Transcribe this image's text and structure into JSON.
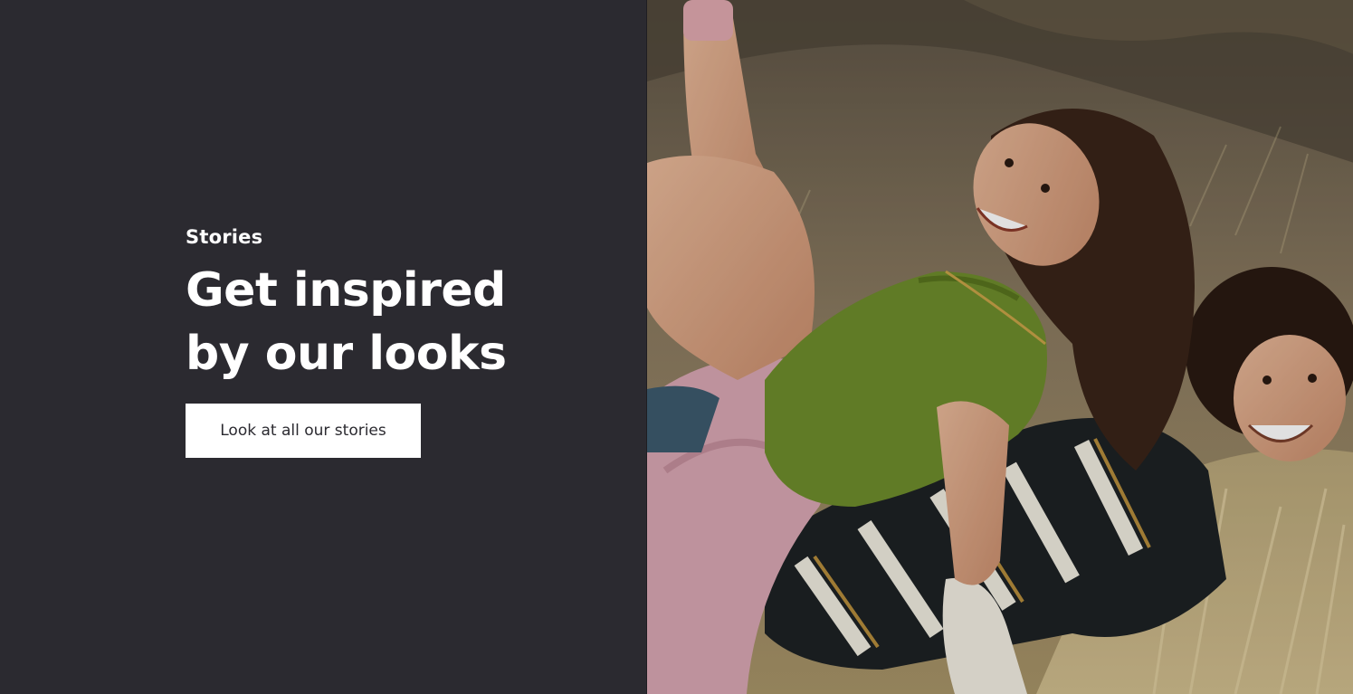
{
  "stories": {
    "eyebrow": "Stories",
    "headline_line1": "Get inspired",
    "headline_line2": "by our looks",
    "cta_label": "Look at all our stories"
  },
  "colors": {
    "panel_background": "#2b2a30",
    "text": "#ffffff",
    "button_background": "#ffffff",
    "button_text": "#2b2a30"
  },
  "hero_image": {
    "description": "photo-two-people-laughing-hillside"
  }
}
